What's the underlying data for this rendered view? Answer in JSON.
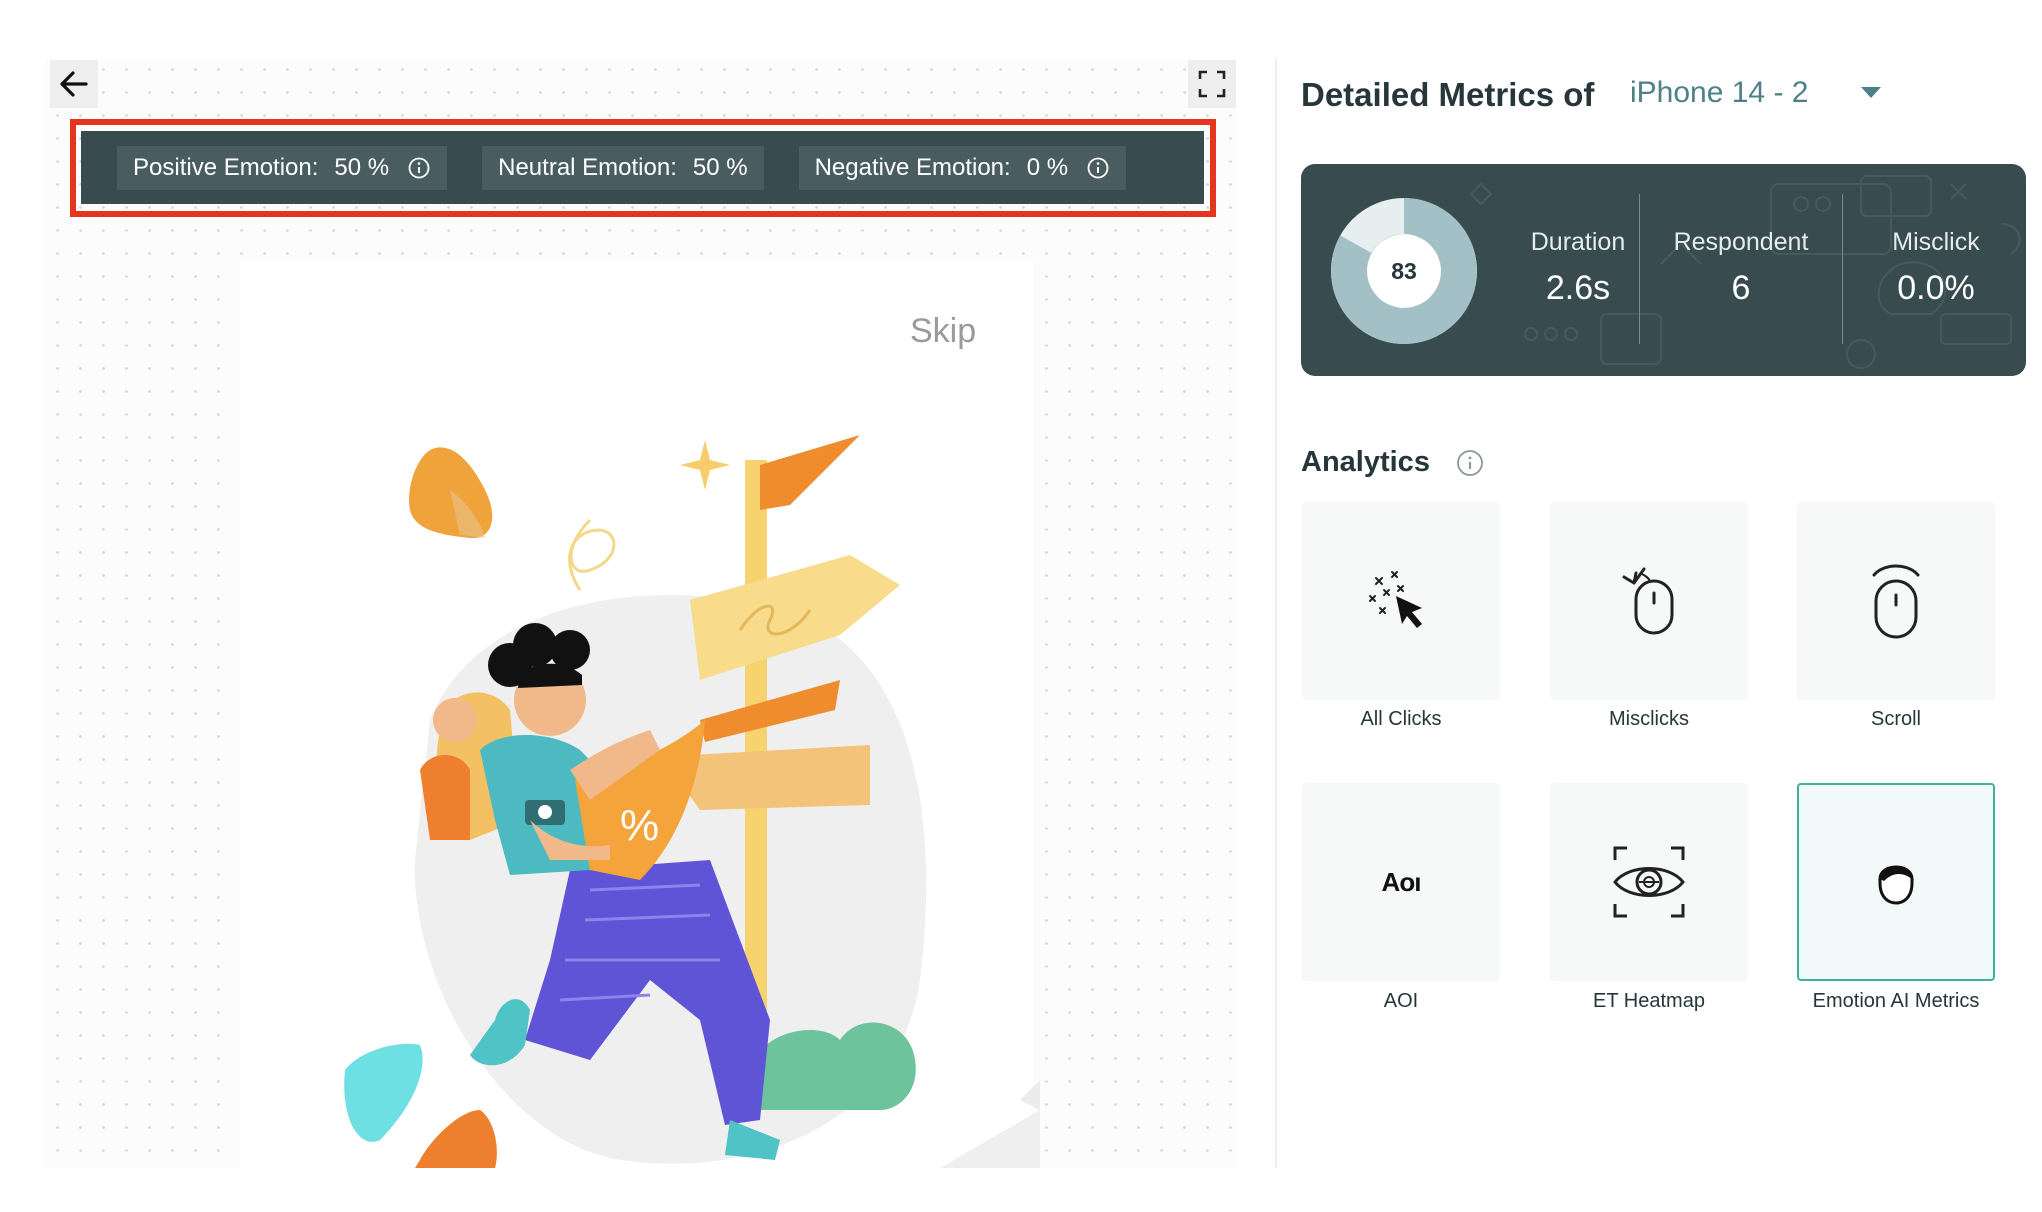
{
  "emotion_bar": {
    "positive_label": "Positive Emotion:",
    "positive_value": "50 %",
    "neutral_label": "Neutral Emotion:",
    "neutral_value": "50 %",
    "negative_label": "Negative Emotion:",
    "negative_value": "0 %"
  },
  "preview": {
    "skip_label": "Skip",
    "illustration_sign_text": "%"
  },
  "metrics": {
    "title": "Detailed Metrics of",
    "device": "iPhone 14 - 2",
    "score": "83",
    "score_fraction": 0.83,
    "stats": [
      {
        "label": "Duration",
        "value": "2.6s"
      },
      {
        "label": "Respondent",
        "value": "6"
      },
      {
        "label": "Misclick",
        "value": "0.0%"
      }
    ]
  },
  "analytics": {
    "title": "Analytics",
    "tiles": [
      {
        "label": "All Clicks",
        "icon": "all-clicks-icon"
      },
      {
        "label": "Misclicks",
        "icon": "misclicks-icon"
      },
      {
        "label": "Scroll",
        "icon": "scroll-icon"
      },
      {
        "label": "AOI",
        "icon": "aoi-icon",
        "icon_text": "Aoı"
      },
      {
        "label": "ET Heatmap",
        "icon": "eye-tracking-icon"
      },
      {
        "label": "Emotion AI Metrics",
        "icon": "emotion-face-icon",
        "selected": true
      }
    ]
  },
  "colors": {
    "dark_panel": "#384b4f",
    "chip": "#495c60",
    "highlight_border": "#e5351f",
    "accent_teal": "#3cb39c",
    "device_link": "#4d8088"
  }
}
